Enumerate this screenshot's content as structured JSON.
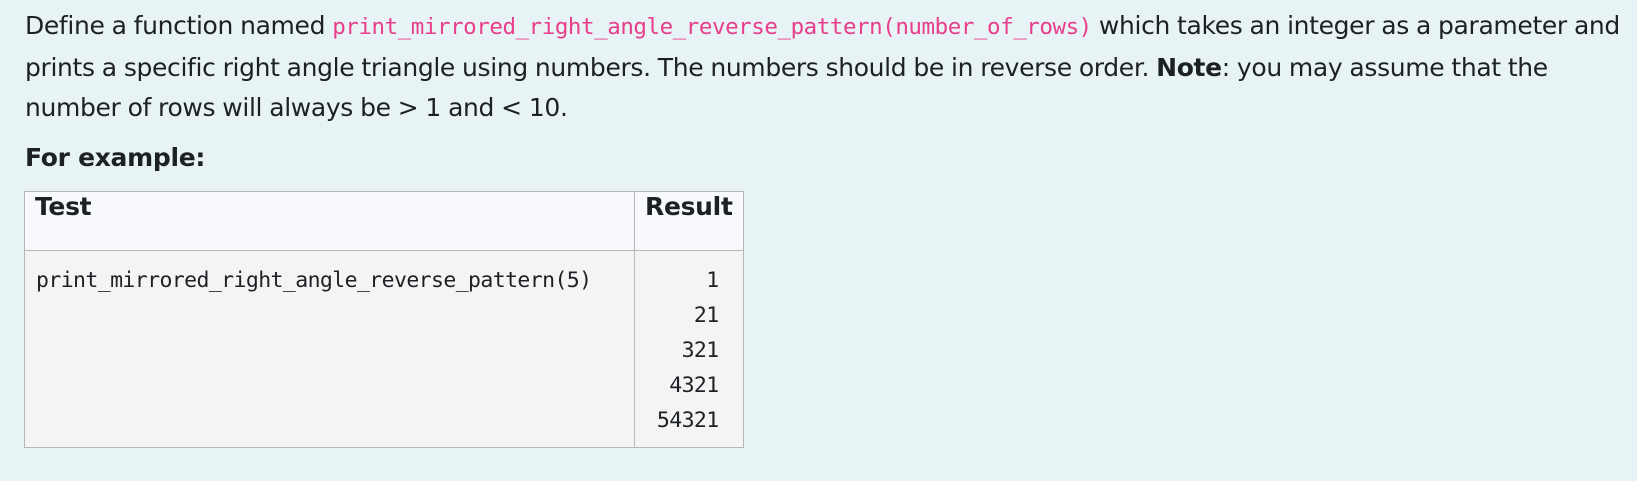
{
  "question": {
    "text_before": "Define a function named ",
    "function_signature": "print_mirrored_right_angle_reverse_pattern(number_of_rows)",
    "text_after": " which takes an integer as a parameter and prints a specific right angle triangle using numbers. The numbers should be in reverse order. ",
    "note_label": "Note",
    "note_text": ": you may assume that the number of rows will always be > 1 and < 10."
  },
  "example_heading": "For example:",
  "examples_table": {
    "headers": [
      "Test",
      "Result"
    ],
    "rows": [
      {
        "test": "print_mirrored_right_angle_reverse_pattern(5)",
        "result_lines": [
          "1",
          "21",
          "321",
          "4321",
          "54321"
        ]
      }
    ]
  },
  "colors": {
    "page_background": "#e7f3f5",
    "inline_code": "#e83e8c",
    "table_cell_background": "#f4f4f4",
    "table_header_background": "#f7f9fc",
    "table_border": "#b7b7b7"
  }
}
